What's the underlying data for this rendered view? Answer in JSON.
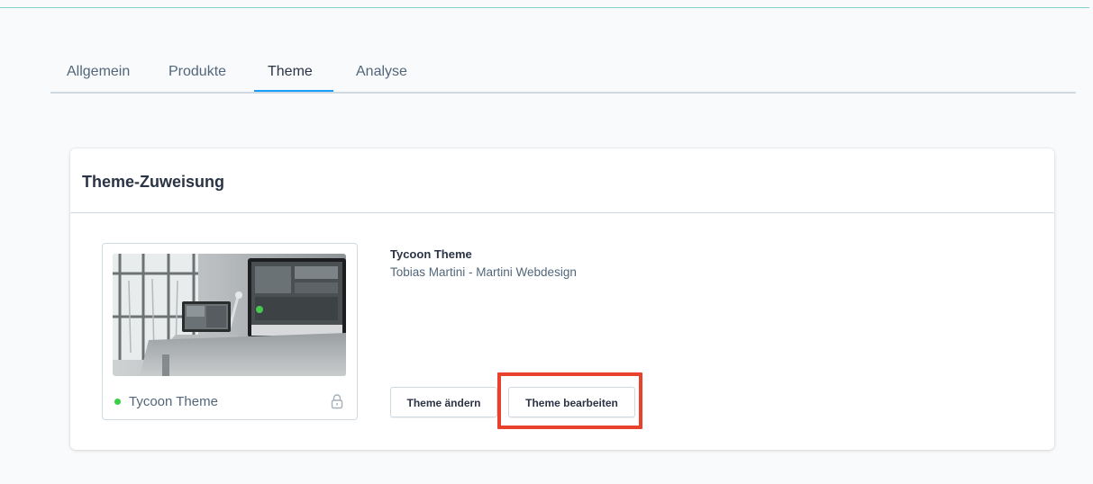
{
  "tabs": [
    {
      "label": "Allgemein",
      "active": false
    },
    {
      "label": "Produkte",
      "active": false
    },
    {
      "label": "Theme",
      "active": true
    },
    {
      "label": "Analyse",
      "active": false
    }
  ],
  "card": {
    "title": "Theme-Zuweisung"
  },
  "theme": {
    "preview_label": "Tycoon Theme",
    "status": "active",
    "name": "Tycoon Theme",
    "author": "Tobias Martini - Martini Webdesign"
  },
  "buttons": {
    "change": "Theme ändern",
    "edit": "Theme bearbeiten"
  },
  "colors": {
    "accent": "#189eff",
    "status_active": "#37d046",
    "highlight": "#e8412c",
    "text_dark": "#2b3445",
    "text": "#52667a"
  },
  "icons": {
    "lock": "lock-icon",
    "status": "status-dot-icon"
  }
}
